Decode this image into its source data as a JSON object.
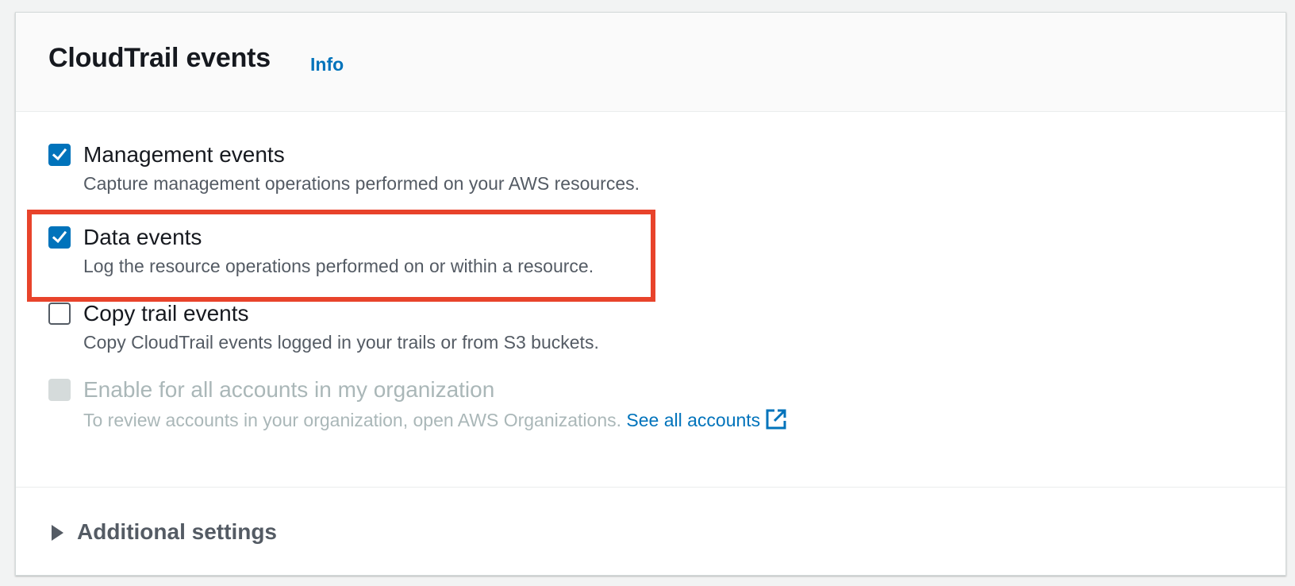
{
  "panel": {
    "title": "CloudTrail events",
    "info_link": "Info"
  },
  "options": [
    {
      "label": "Management events",
      "description": "Capture management operations performed on your AWS resources.",
      "checked": true,
      "disabled": false
    },
    {
      "label": "Data events",
      "description": "Log the resource operations performed on or within a resource.",
      "checked": true,
      "disabled": false,
      "highlighted": true
    },
    {
      "label": "Copy trail events",
      "description": "Copy CloudTrail events logged in your trails or from S3 buckets.",
      "checked": false,
      "disabled": false
    },
    {
      "label": "Enable for all accounts in my organization",
      "description": "To review accounts in your organization, open AWS Organizations.",
      "link_text": "See all accounts",
      "link_icon": "external-link-icon",
      "checked": false,
      "disabled": true
    }
  ],
  "additional_settings": {
    "label": "Additional settings",
    "icon": "caret-right-icon",
    "expanded": false
  },
  "colors": {
    "accent": "#0073bb",
    "highlight": "#e8432b",
    "text": "#16191f",
    "secondary_text": "#545b64",
    "disabled_text": "#aab7b8"
  }
}
